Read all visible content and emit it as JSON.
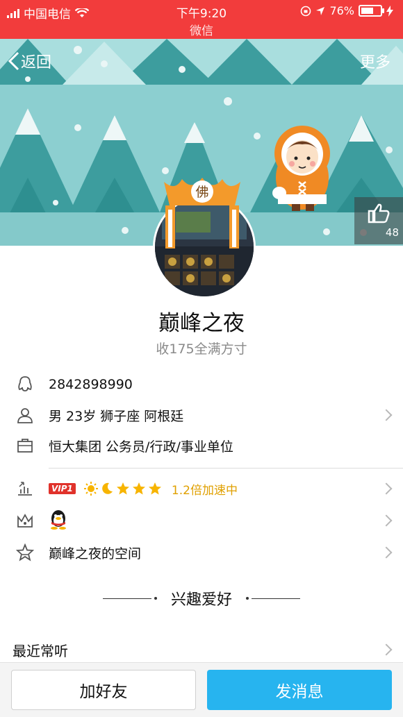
{
  "status_bar": {
    "carrier": "中国电信",
    "time": "下午9:20",
    "app_name": "微信",
    "battery": "76%",
    "battery_level": 0.76
  },
  "nav": {
    "back_label": "返回",
    "more_label": "更多"
  },
  "like": {
    "count": "48"
  },
  "profile": {
    "nickname": "巅峰之夜",
    "signature": "收175全满方寸",
    "crown_char": "佛"
  },
  "info": {
    "qq_number": "2842898990",
    "basic": "男 23岁 狮子座 阿根廷",
    "company": "恒大集团 公务员/行政/事业单位",
    "vip_badge": "VIP1",
    "speed_text": "1.2倍加速中",
    "zone": "巅峰之夜的空间"
  },
  "section": {
    "interests_title": "兴趣爱好",
    "recent_listen": "最近常听"
  },
  "buttons": {
    "add_friend": "加好友",
    "send_message": "发消息"
  },
  "colors": {
    "status_bar": "#f23c3c",
    "primary_button": "#27b4ef",
    "banner_bg": "#8ccfd0"
  }
}
